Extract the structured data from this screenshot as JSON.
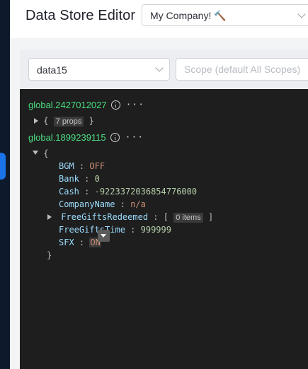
{
  "header": {
    "title": "Data Store Editor",
    "company": "My Company! 🔨"
  },
  "filters": {
    "store": "data15",
    "scope_placeholder": "Scope (default All Scopes)"
  },
  "entries": [
    {
      "key": "global.2427012027",
      "collapsed_summary": "7 props"
    },
    {
      "key": "global.1899239115",
      "props": [
        {
          "name": "BGM",
          "value": "OFF"
        },
        {
          "name": "Bank",
          "value": "0"
        },
        {
          "name": "Cash",
          "value": "-9223372036854776000"
        },
        {
          "name": "CompanyName",
          "value": "n/a"
        },
        {
          "name": "FreeGiftsRedeemed",
          "summary": "0 items"
        },
        {
          "name": "FreeGiftsTime",
          "value": "999999"
        },
        {
          "name": "SFX",
          "value": "ON"
        }
      ]
    }
  ],
  "syntax": {
    "open_brace": "{",
    "close_brace": "}",
    "open_bracket": "[",
    "close_bracket": "]",
    "colon": ":",
    "more": "···"
  },
  "colors": {
    "key": "#4ade80",
    "prop": "#9cdcfe",
    "string": "#ce9178",
    "number": "#b5cea8",
    "viewer_bg": "#1e1e1e"
  }
}
